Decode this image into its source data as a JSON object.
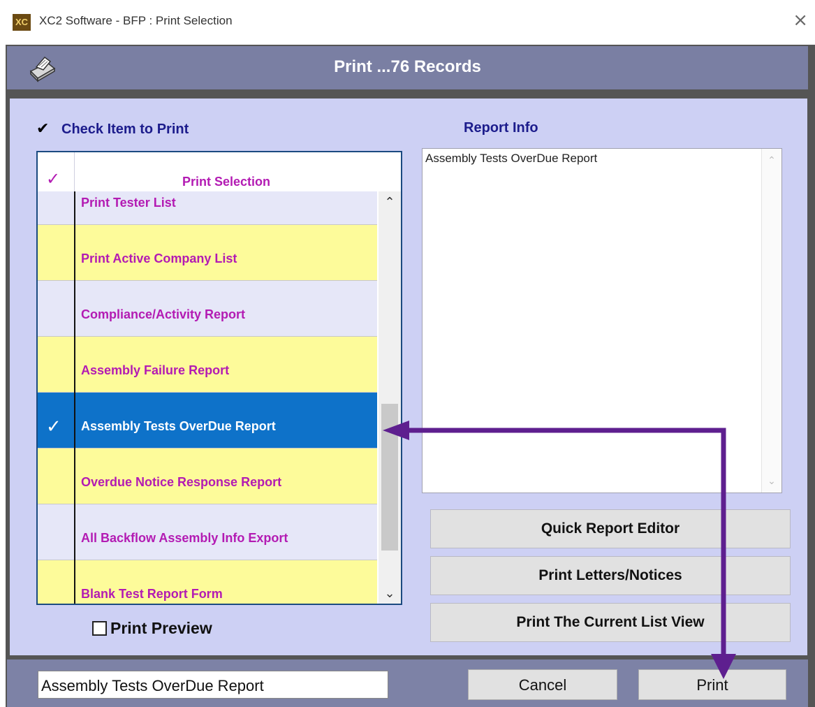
{
  "window": {
    "logo_text": "XC",
    "title": "XC2 Software - BFP : Print Selection",
    "close_glyph": "×"
  },
  "header": {
    "title": "Print ...76 Records",
    "icon": "printer-icon"
  },
  "list_section": {
    "title": "Check Item to Print",
    "title_mark": "✔",
    "column_header": "Print Selection",
    "header_mark": "✓",
    "items": [
      {
        "label": "Print Tester List",
        "color": "blue",
        "checked": false
      },
      {
        "label": "Print Active Company List",
        "color": "yellow",
        "checked": false
      },
      {
        "label": "Compliance/Activity  Report",
        "color": "blue",
        "checked": false
      },
      {
        "label": "Assembly Failure Report",
        "color": "yellow",
        "checked": false
      },
      {
        "label": "Assembly Tests OverDue Report",
        "color": "selected",
        "checked": true,
        "mark": "✓"
      },
      {
        "label": "Overdue Notice Response Report",
        "color": "yellow",
        "checked": false
      },
      {
        "label": "All Backflow Assembly Info Export",
        "color": "blue",
        "checked": false
      },
      {
        "label": "Blank Test Report Form",
        "color": "yellow",
        "checked": false
      }
    ]
  },
  "print_preview": {
    "label": "Print Preview",
    "checked": false
  },
  "report_info": {
    "title": "Report Info",
    "text": "Assembly Tests OverDue Report"
  },
  "side_buttons": {
    "quick_report_editor": "Quick Report Editor",
    "print_letters": "Print Letters/Notices",
    "print_list_view": "Print The Current List View"
  },
  "bottom": {
    "selected_report": "Assembly Tests OverDue Report",
    "cancel_label": "Cancel",
    "print_label": "Print"
  },
  "colors": {
    "accent_purple": "#b31bb3",
    "selection_blue": "#0e72c9",
    "row_yellow": "#fdfb9a",
    "row_blue": "#e6e7f8",
    "annotation_arrow": "#5e1f8f"
  }
}
